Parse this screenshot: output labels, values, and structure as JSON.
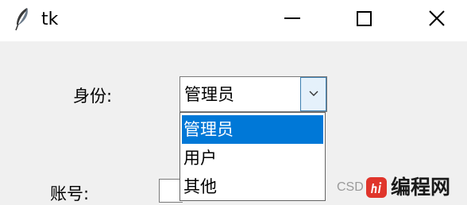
{
  "window": {
    "title": "tk",
    "icon": "feather-icon",
    "controls": {
      "minimize_icon": "minimize-icon",
      "maximize_icon": "maximize-icon",
      "close_icon": "close-icon"
    }
  },
  "form": {
    "identity_label": "身份:",
    "identity_value": "管理员",
    "identity_options": [
      "管理员",
      "用户",
      "其他"
    ],
    "account_label": "账号:"
  },
  "watermark": {
    "prefix": "CSD",
    "text": "编程网",
    "logo": "php-logo"
  },
  "colors": {
    "selection": "#0078d7",
    "arrow_hover": "#e5f1fb",
    "arrow_border": "#3c7fb1",
    "logo_red": "#e0352b"
  }
}
